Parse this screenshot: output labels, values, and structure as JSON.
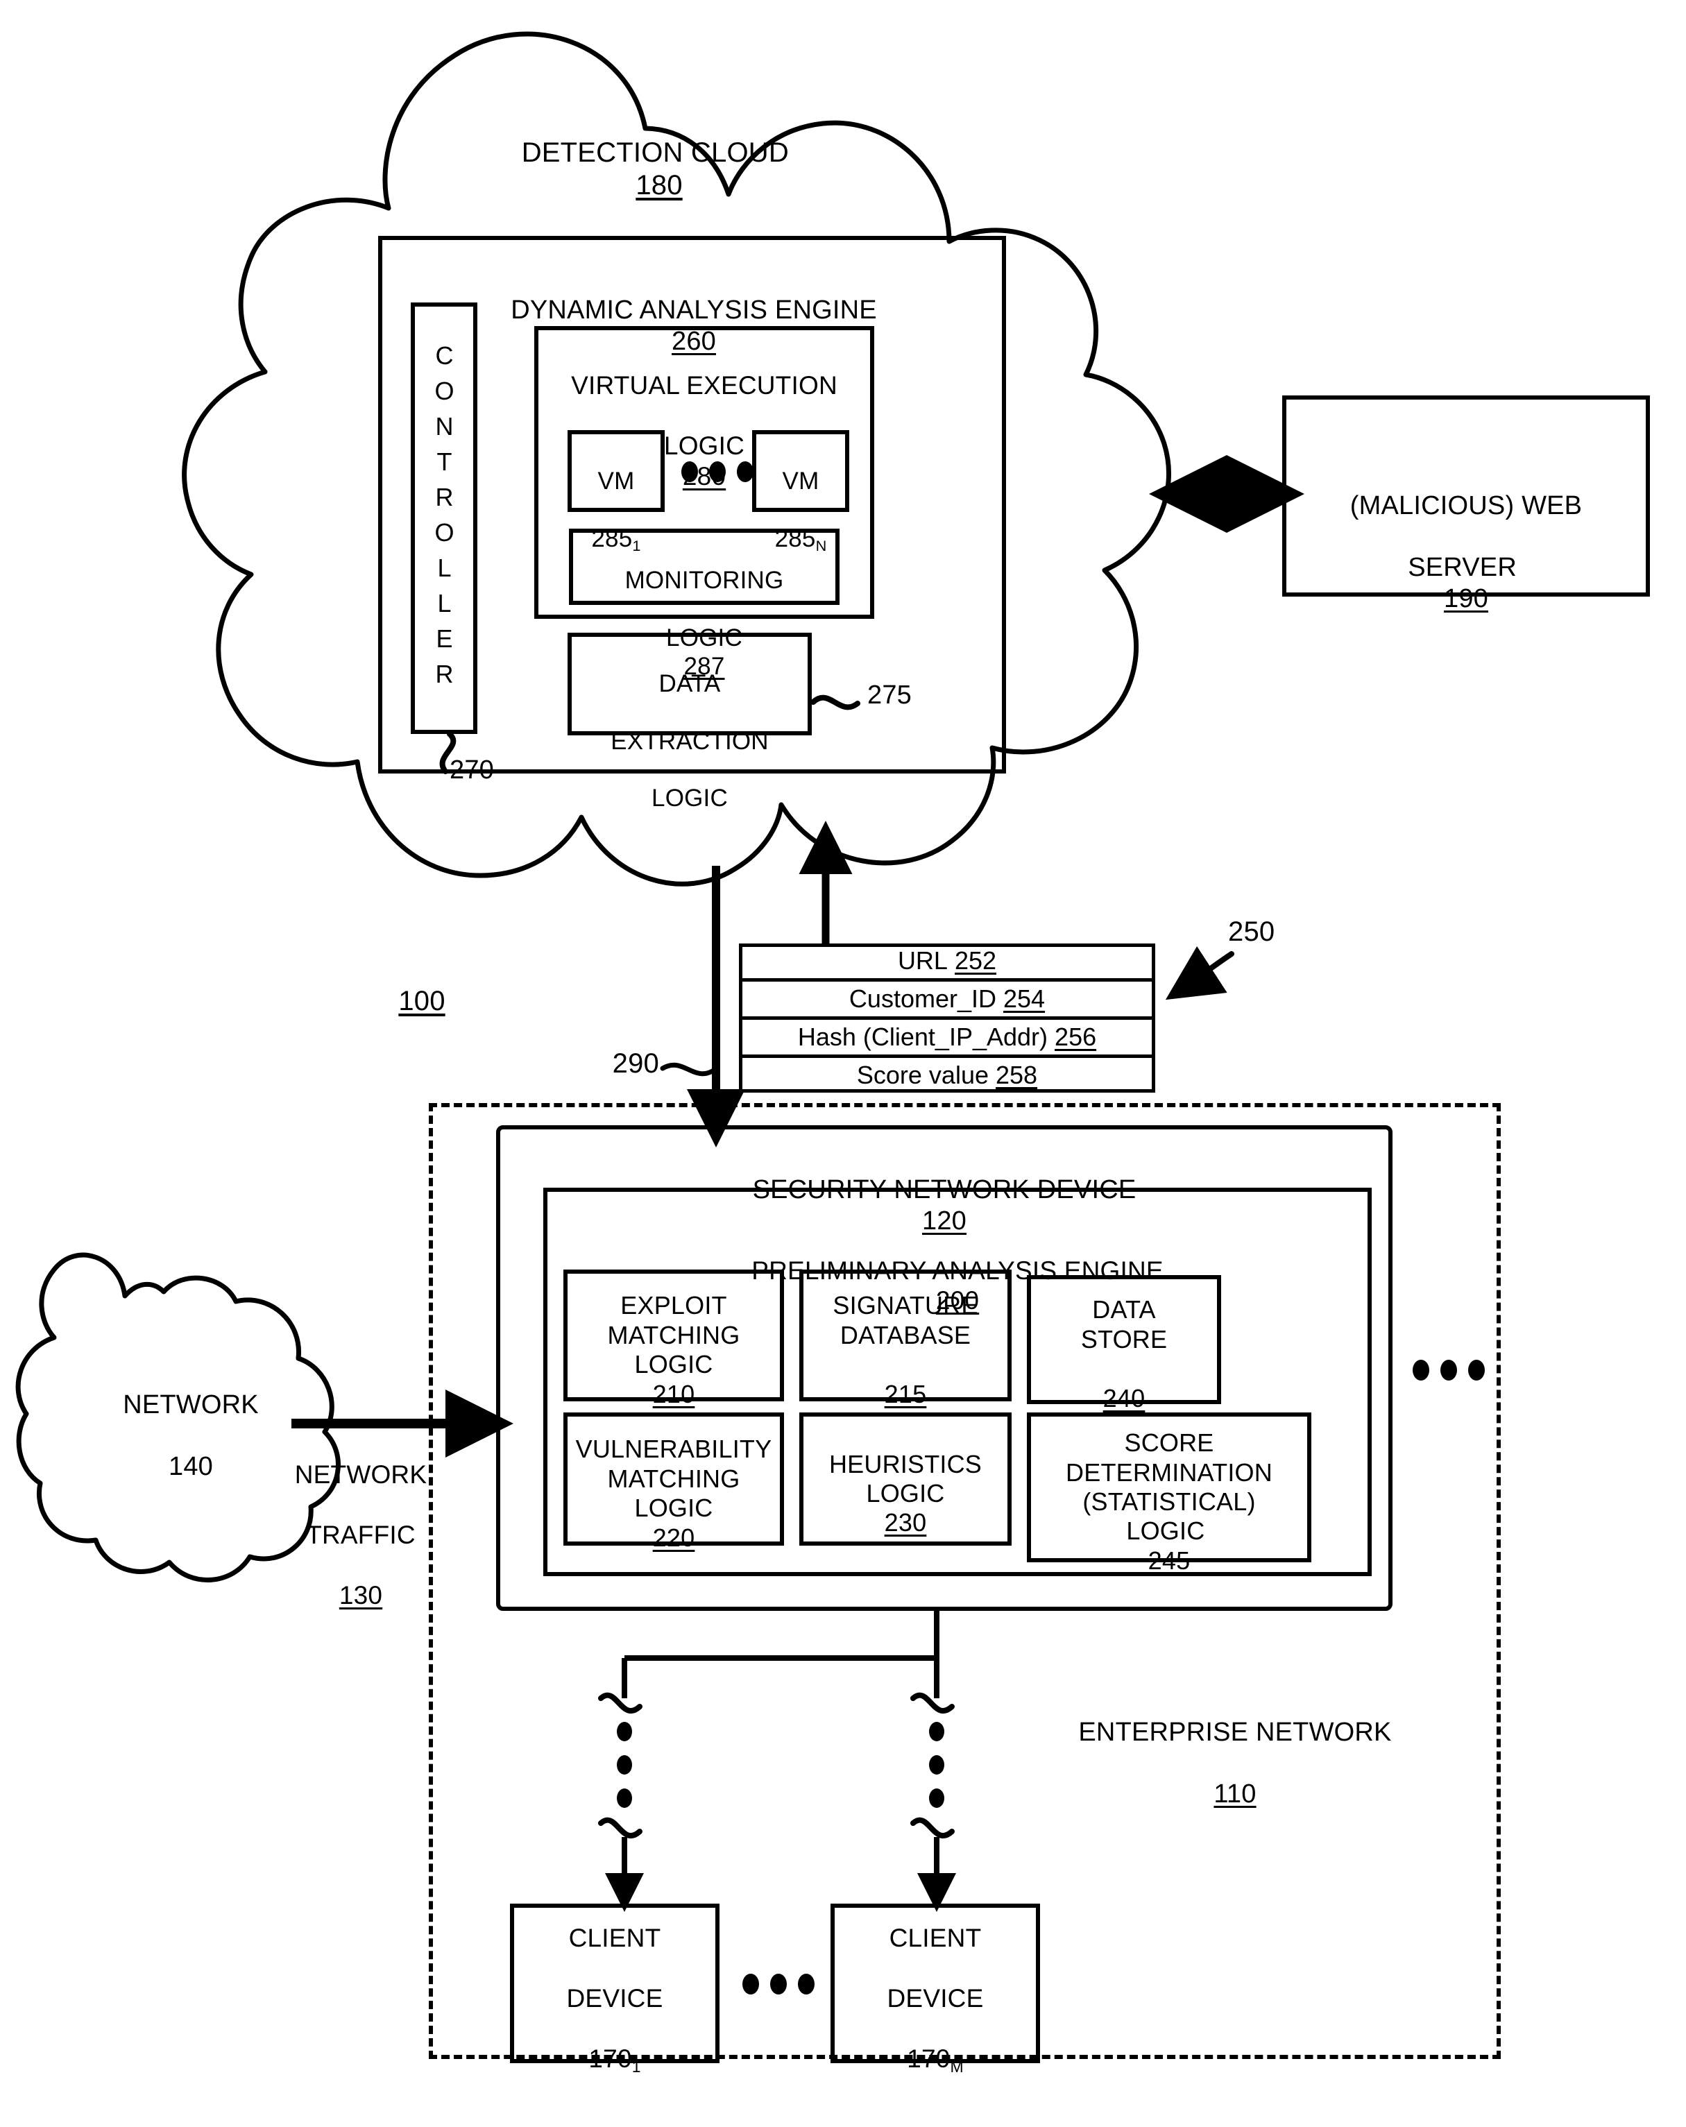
{
  "figure": {
    "system_ref": "100",
    "detection_cloud": {
      "label": "DETECTION CLOUD",
      "ref": "180"
    },
    "dynamic_analysis_engine": {
      "label": "DYNAMIC ANALYSIS ENGINE",
      "ref": "260",
      "controller": {
        "label": "CONTROLLER",
        "ref": "270"
      },
      "virtual_execution_logic": {
        "line1": "VIRTUAL EXECUTION",
        "line2": "LOGIC",
        "ref": "280",
        "vms": [
          {
            "label": "VM",
            "ref": "285",
            "sub": "1"
          },
          {
            "label": "VM",
            "ref": "285",
            "sub": "N"
          }
        ],
        "vm_ellipsis": "•••",
        "monitoring_logic": {
          "line1": "MONITORING",
          "line2": "LOGIC",
          "ref": "287"
        }
      },
      "data_extraction_logic": {
        "line1": "DATA",
        "line2": "EXTRACTION",
        "line3": "LOGIC",
        "ref": "275"
      }
    },
    "web_server": {
      "line1": "(MALICIOUS) WEB",
      "line2": "SERVER",
      "ref": "190"
    },
    "message": {
      "ref": "250",
      "rows": [
        {
          "text": "URL",
          "ref": "252"
        },
        {
          "text": "Customer_ID",
          "ref": "254"
        },
        {
          "text": "Hash (Client_IP_Addr)",
          "ref": "256"
        },
        {
          "text": "Score value",
          "ref": "258"
        }
      ]
    },
    "flow_ref_290": "290",
    "network_cloud": {
      "label": "NETWORK",
      "ref": "140"
    },
    "network_traffic": {
      "line1": "NETWORK",
      "line2": "TRAFFIC",
      "ref": "130"
    },
    "enterprise_network": {
      "label": "ENTERPRISE NETWORK",
      "ref": "110"
    },
    "security_network_device": {
      "label": "SECURITY NETWORK DEVICE",
      "ref": "120",
      "preliminary_analysis_engine": {
        "label": "PRELIMINARY ANALYSIS ENGINE",
        "ref": "200",
        "modules": [
          {
            "lines": "EXPLOIT\nMATCHING\nLOGIC",
            "ref": "210",
            "inline_ref": true
          },
          {
            "lines": "SIGNATURE\nDATABASE",
            "ref": "215",
            "inline_ref": false
          },
          {
            "lines": "DATA\nSTORE",
            "ref": "240",
            "inline_ref": false
          },
          {
            "lines": "VULNERABILITY\nMATCHING\nLOGIC",
            "ref": "220",
            "inline_ref": true
          },
          {
            "lines": "HEURISTICS\nLOGIC",
            "ref": "230",
            "inline_ref": true
          },
          {
            "lines": "SCORE\nDETERMINATION\n(STATISTICAL)\nLOGIC",
            "ref": "245",
            "inline_ref": true
          }
        ]
      },
      "more_ellipsis": "•••"
    },
    "client_devices": [
      {
        "line1": "CLIENT",
        "line2": "DEVICE",
        "ref": "170",
        "sub": "1"
      },
      {
        "line1": "CLIENT",
        "line2": "DEVICE",
        "ref": "170",
        "sub": "M"
      }
    ],
    "client_ellipsis": "•••"
  },
  "colors": {
    "ink": "#000000",
    "paper": "#ffffff"
  }
}
